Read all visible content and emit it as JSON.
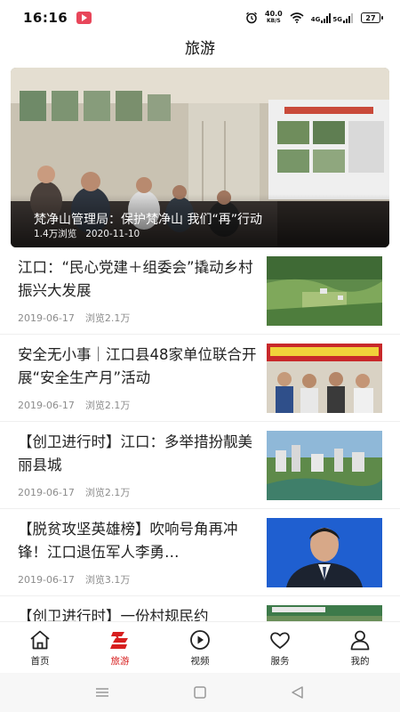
{
  "status_bar": {
    "time": "16:16",
    "net_speed_value": "40.0",
    "net_speed_unit": "KB/S",
    "signal_label": "4G",
    "signal_label_2": "5G",
    "battery": "27",
    "icons": [
      "notification-app-icon",
      "alarm-icon",
      "wifi-icon",
      "signal-icon",
      "battery-icon"
    ]
  },
  "header": {
    "title": "旅游"
  },
  "banner": {
    "title": "梵净山管理局：保护梵净山 我们“再”行动",
    "views": "1.4万浏览",
    "date": "2020-11-10"
  },
  "articles": [
    {
      "title": "江口：“民心党建＋组委会”撬动乡村振兴大发展",
      "date": "2019-06-17",
      "views": "浏览2.1万",
      "thumb": "village-fields"
    },
    {
      "title": "安全无小事｜江口县48家单位联合开展“安全生产月”活动",
      "date": "2019-06-17",
      "views": "浏览2.1万",
      "thumb": "safety-event"
    },
    {
      "title": "【创卫进行时】江口：多举措扮靓美丽县城",
      "date": "2019-06-17",
      "views": "浏览2.1万",
      "thumb": "city-river"
    },
    {
      "title": "【脱贫攻坚英雄榜】吹响号角再冲锋！江口退伍军人李勇…",
      "date": "2019-06-17",
      "views": "浏览3.1万",
      "thumb": "portrait"
    },
    {
      "title": "【创卫进行时】一份村规民约",
      "date": "",
      "views": "",
      "thumb": "village-sign"
    }
  ],
  "bottom_nav": [
    {
      "label": "首页",
      "icon": "home-icon",
      "active": false
    },
    {
      "label": "旅游",
      "icon": "travel-icon",
      "active": true
    },
    {
      "label": "视频",
      "icon": "play-icon",
      "active": false
    },
    {
      "label": "服务",
      "icon": "heart-icon",
      "active": false
    },
    {
      "label": "我的",
      "icon": "user-icon",
      "active": false
    }
  ],
  "colors": {
    "accent": "#d71f1f",
    "meta_text": "#8c8c8c",
    "title_text": "#222222"
  }
}
